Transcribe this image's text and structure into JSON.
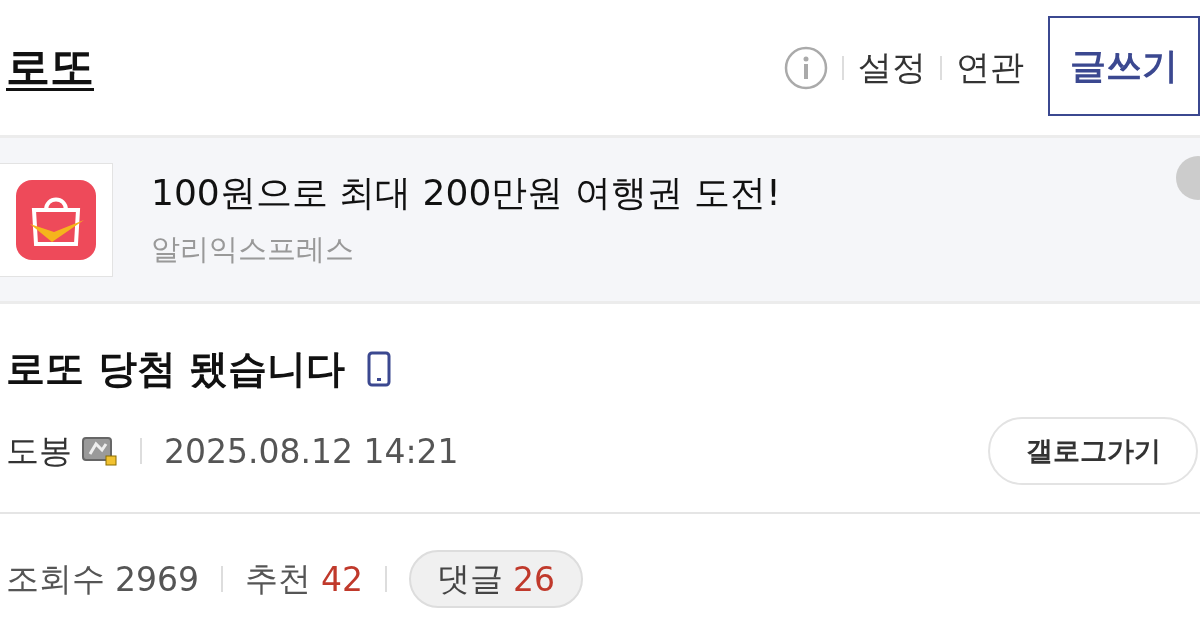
{
  "header": {
    "title": "로또",
    "links": [
      "설정",
      "연관"
    ],
    "write_button": "글쓰기"
  },
  "ad": {
    "headline": "100원으로 최대 200만원 여행권 도전!",
    "advertiser": "알리익스프레스"
  },
  "post": {
    "title": "로또 당첨 됐습니다",
    "author": "도봉",
    "date": "2025.08.12 14:21",
    "gallog_button": "갤로그가기",
    "stats": [
      {
        "label": "조회수",
        "value": "2969",
        "highlight": false
      },
      {
        "label": "추천",
        "value": "42",
        "highlight": true
      }
    ],
    "comments": {
      "label": "댓글",
      "value": "26"
    }
  }
}
